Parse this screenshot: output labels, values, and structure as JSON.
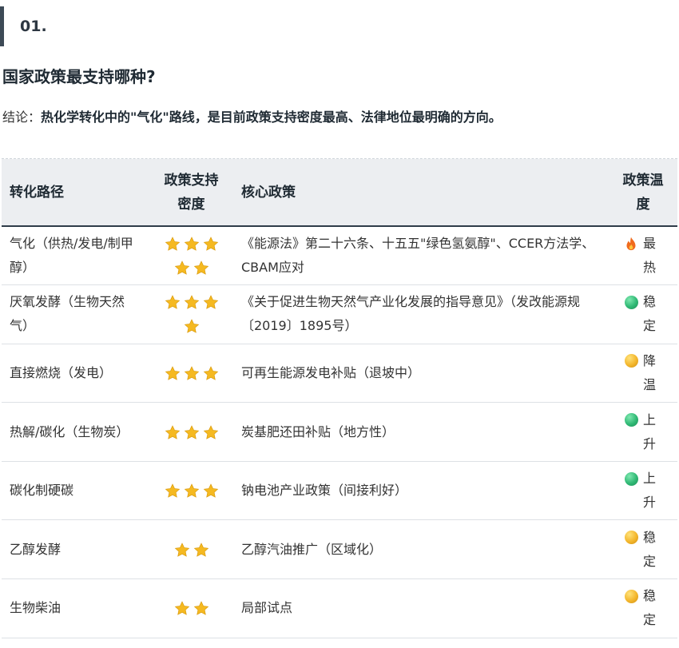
{
  "section": {
    "number": "01."
  },
  "question": "国家政策最支持哪种?",
  "conclusion": {
    "prefix": "结论：",
    "body": "热化学转化中的\"气化\"路线，是目前政策支持密度最高、法律地位最明确的方向。"
  },
  "table": {
    "headers": {
      "path": "转化路径",
      "density": "政策支持密度",
      "policy": "核心政策",
      "temp": "政策温度"
    },
    "rows": [
      {
        "path": "气化（供热/发电/制甲醇）",
        "stars": 5,
        "policy": "《能源法》第二十六条、十五五\"绿色氢氨醇\"、CCER方法学、CBAM应对",
        "temp_icon": "fire-icon",
        "temp": "最热"
      },
      {
        "path": "厌氧发酵（生物天然气）",
        "stars": 4,
        "policy": "《关于促进生物天然气产业化发展的指导意见》（发改能源规〔2019〕1895号）",
        "temp_icon": "green-circle-icon",
        "temp": "稳定"
      },
      {
        "path": "直接燃烧（发电）",
        "stars": 3,
        "policy": "可再生能源发电补贴（退坡中）",
        "temp_icon": "yellow-circle-icon",
        "temp": "降温"
      },
      {
        "path": "热解/碳化（生物炭）",
        "stars": 3,
        "policy": "炭基肥还田补贴（地方性）",
        "temp_icon": "green-circle-icon",
        "temp": "上升"
      },
      {
        "path": "碳化制硬碳",
        "stars": 3,
        "policy": "钠电池产业政策（间接利好）",
        "temp_icon": "green-circle-icon",
        "temp": "上升"
      },
      {
        "path": "乙醇发酵",
        "stars": 2,
        "policy": "乙醇汽油推广（区域化）",
        "temp_icon": "yellow-circle-icon",
        "temp": "稳定"
      },
      {
        "path": "生物柴油",
        "stars": 2,
        "policy": "局部试点",
        "temp_icon": "yellow-circle-icon",
        "temp": "稳定"
      }
    ]
  },
  "colors": {
    "accent_bar": "#3d4a56",
    "header_bg": "#eceef1",
    "star": "#f5b921",
    "green": "#2fb874",
    "yellow": "#f3b62c",
    "fire": "#f06a1d"
  }
}
